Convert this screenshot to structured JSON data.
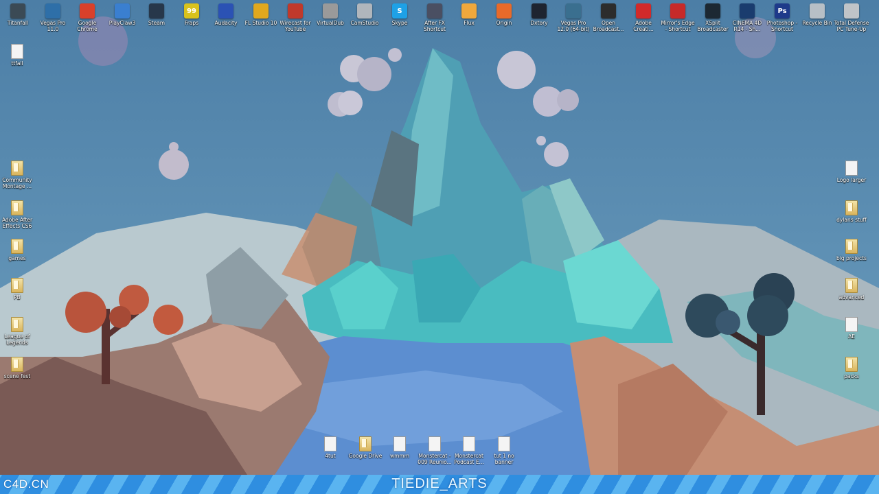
{
  "colors": {
    "sky": "#4f7fa5",
    "strip_light": "#5ab4f0",
    "strip_dark": "#2f8ee0",
    "mountain": "#5fc7c8",
    "tree_red": "#b9543c",
    "tree_dark": "#2e4a5c"
  },
  "top_icons": [
    {
      "label": "Titanfall",
      "icon": "titanfall-icon",
      "color": "#3b4a55"
    },
    {
      "label": "Vegas Pro 11.0",
      "icon": "vegas-pro-icon",
      "color": "#2e6fa8"
    },
    {
      "label": "Google Chrome",
      "icon": "chrome-icon",
      "color": "#d9402b"
    },
    {
      "label": "PlayClaw3",
      "icon": "playclaw-icon",
      "color": "#3a7fd0"
    },
    {
      "label": "Steam",
      "icon": "steam-icon",
      "color": "#27374a"
    },
    {
      "label": "Fraps",
      "icon": "fraps-icon",
      "color": "#d8c21c",
      "text": "99"
    },
    {
      "label": "Audacity",
      "icon": "audacity-icon",
      "color": "#2b52b4"
    },
    {
      "label": "FL Studio 10",
      "icon": "fl-studio-icon",
      "color": "#e0a81e"
    },
    {
      "label": "Wirecast for YouTube",
      "icon": "wirecast-icon",
      "color": "#c0392b"
    },
    {
      "label": "VirtualDub",
      "icon": "virtualdub-icon",
      "color": "#9a9a9a"
    },
    {
      "label": "CamStudio",
      "icon": "camstudio-icon",
      "color": "#b0b6bc"
    },
    {
      "label": "Skype",
      "icon": "skype-icon",
      "color": "#1ea1e6",
      "text": "S"
    },
    {
      "label": "After FX Shortcut",
      "icon": "after-effects-shortcut-icon",
      "color": "#4a4f62"
    },
    {
      "label": "Flux",
      "icon": "flux-icon",
      "color": "#f0a83c"
    },
    {
      "label": "Origin",
      "icon": "origin-icon",
      "color": "#e86a2a"
    },
    {
      "label": "Dxtory",
      "icon": "dxtory-icon",
      "color": "#1e2430"
    },
    {
      "label": "Vegas Pro 12.0 (64-bit)",
      "icon": "vegas-pro-12-icon",
      "color": "#3a6f8f"
    },
    {
      "label": "Open Broadcast...",
      "icon": "obs-icon",
      "color": "#2c2c2c"
    },
    {
      "label": "Adobe Creati...",
      "icon": "adobe-creative-cloud-icon",
      "color": "#d22a2a"
    },
    {
      "label": "Mirror's Edge - Shortcut",
      "icon": "mirrors-edge-icon",
      "color": "#c62a2a"
    },
    {
      "label": "XSplit Broadcaster",
      "icon": "xsplit-icon",
      "color": "#1c2833"
    },
    {
      "label": "CINEMA 4D R14 - Sh...",
      "icon": "cinema4d-icon",
      "color": "#1a3c6e"
    },
    {
      "label": "Photoshop - Shortcut",
      "icon": "photoshop-icon",
      "color": "#1e3a8a",
      "text": "Ps"
    },
    {
      "label": "Recycle Bin",
      "icon": "recycle-bin-icon",
      "color": "#b7bfc6"
    },
    {
      "label": "Total Defense PC Tune-Up",
      "icon": "pc-tuneup-icon",
      "color": "#c0c4c8"
    }
  ],
  "left_icons": [
    {
      "label": "ttfall",
      "icon": "file-icon",
      "type": "doc"
    },
    {
      "label": "Community Montage ...",
      "icon": "folder-icon",
      "type": "folder"
    },
    {
      "label": "Adobe After Effects CS6",
      "icon": "folder-icon",
      "type": "folder"
    },
    {
      "label": "games",
      "icon": "folder-icon",
      "type": "folder"
    },
    {
      "label": "PB",
      "icon": "folder-icon",
      "type": "folder"
    },
    {
      "label": "League of Legends",
      "icon": "folder-icon",
      "type": "folder"
    },
    {
      "label": "scene fest",
      "icon": "folder-icon",
      "type": "folder"
    }
  ],
  "right_icons": [
    {
      "label": "Logo larger",
      "icon": "image-file-icon",
      "type": "doc"
    },
    {
      "label": "dylans stuff",
      "icon": "folder-icon",
      "type": "folder"
    },
    {
      "label": "big projects",
      "icon": "folder-icon",
      "type": "folder"
    },
    {
      "label": "advanced",
      "icon": "folder-icon",
      "type": "folder"
    },
    {
      "label": "AE",
      "icon": "ae-project-icon",
      "type": "doc"
    },
    {
      "label": "packs",
      "icon": "folder-icon",
      "type": "folder"
    }
  ],
  "bottom_icons": [
    {
      "label": "4tut",
      "icon": "file-icon",
      "type": "doc"
    },
    {
      "label": "Google Drive",
      "icon": "google-drive-folder-icon",
      "type": "folder"
    },
    {
      "label": "wmmm",
      "icon": "file-icon",
      "type": "doc"
    },
    {
      "label": "Monstercat - 009 Reunio...",
      "icon": "audio-file-icon",
      "type": "doc"
    },
    {
      "label": "Monstercat Podcast E...",
      "icon": "audio-file-icon",
      "type": "doc"
    },
    {
      "label": "tut 1 no banner",
      "icon": "file-icon",
      "type": "doc"
    }
  ],
  "brand": {
    "left": "C4D.CN",
    "center": "TIEDIE_ARTS"
  }
}
